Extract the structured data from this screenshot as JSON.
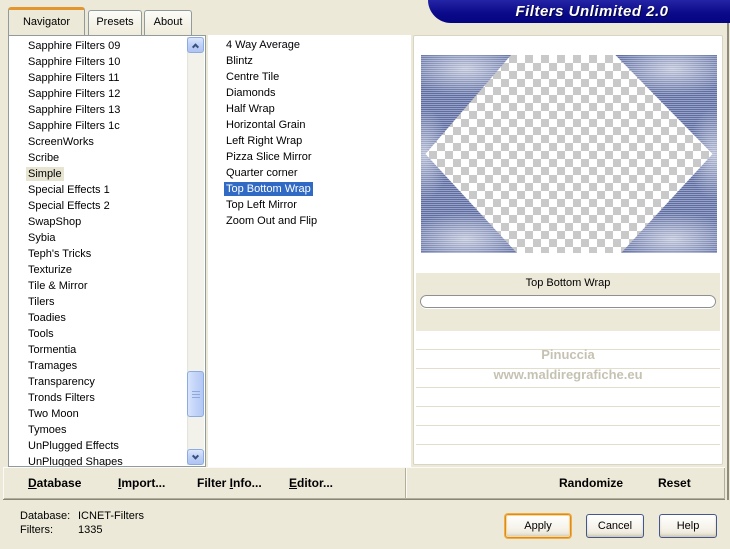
{
  "window": {
    "title": "Filters Unlimited 2.0"
  },
  "tabs": [
    {
      "label": "Navigator",
      "active": true
    },
    {
      "label": "Presets",
      "active": false
    },
    {
      "label": "About",
      "active": false
    }
  ],
  "category_list": {
    "items": [
      "Sapphire Filters 09",
      "Sapphire Filters 10",
      "Sapphire Filters 11",
      "Sapphire Filters 12",
      "Sapphire Filters 13",
      "Sapphire Filters 1c",
      "ScreenWorks",
      "Scribe",
      {
        "label": "Simple",
        "selected": true
      },
      "Special Effects 1",
      "Special Effects 2",
      "SwapShop",
      "Sybia",
      "Teph's Tricks",
      "Texturize",
      "Tile & Mirror",
      "Tilers",
      "Toadies",
      "Tools",
      "Tormentia",
      "Tramages",
      "Transparency",
      "Tronds Filters",
      "Two Moon",
      "Tymoes",
      "UnPlugged Effects",
      "UnPlugged Shapes"
    ]
  },
  "filter_list": {
    "items": [
      "4 Way Average",
      "Blintz",
      "Centre Tile",
      "Diamonds",
      "Half Wrap",
      "Horizontal Grain",
      "Left Right Wrap",
      "Pizza Slice Mirror",
      "Quarter corner",
      {
        "label": "Top Bottom Wrap",
        "selected": true
      },
      "Top Left Mirror",
      "Zoom Out and Flip"
    ]
  },
  "preview": {
    "caption": "Top Bottom Wrap",
    "watermark": [
      "Pinuccia",
      "www.maldiregrafiche.eu"
    ]
  },
  "toolbar": {
    "items": [
      {
        "pre": "",
        "key": "D",
        "post": "atabase"
      },
      {
        "pre": "",
        "key": "I",
        "post": "mport..."
      },
      {
        "pre": "Filter ",
        "key": "I",
        "post": "nfo..."
      },
      {
        "pre": "",
        "key": "E",
        "post": "ditor..."
      }
    ],
    "randomize": "Randomize",
    "reset": "Reset"
  },
  "status": {
    "database_label": "Database:",
    "database_value": "ICNET-Filters",
    "filters_label": "Filters:",
    "filters_value": "1335"
  },
  "actions": {
    "apply": "Apply",
    "cancel": "Cancel",
    "help": "Help"
  },
  "colors": {
    "dialog_bg": "#ECE9D8",
    "accent_selection": "#316AC5",
    "banner": "#0B0B8B",
    "tab_accent": "#E5952E"
  }
}
